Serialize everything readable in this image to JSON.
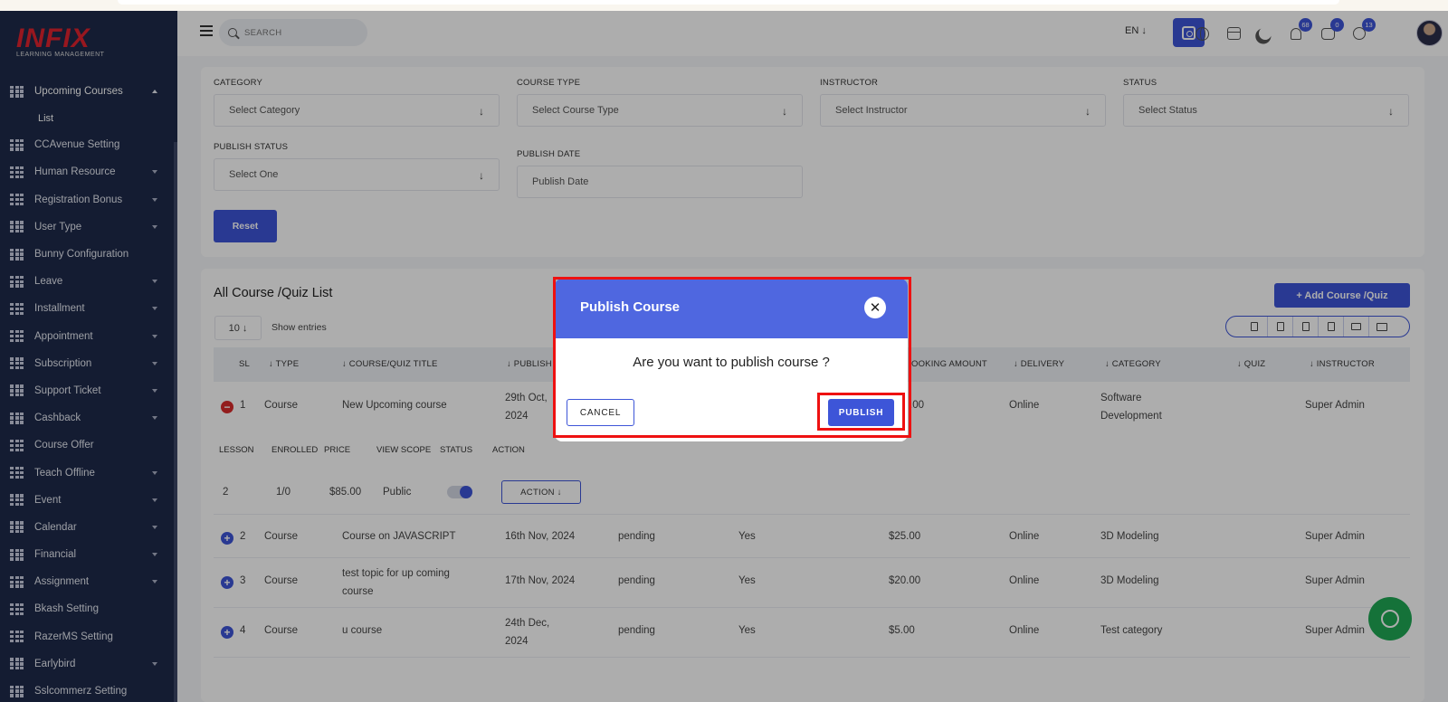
{
  "brand": {
    "logo_text": "INFIX",
    "logo_sub": "LEARNING MANAGEMENT"
  },
  "sidebar": {
    "items": [
      {
        "label": "Upcoming Courses",
        "caret": "up"
      },
      {
        "label": "List",
        "sub": true
      },
      {
        "label": "CCAvenue Setting",
        "caret": ""
      },
      {
        "label": "Human Resource",
        "caret": "down"
      },
      {
        "label": "Registration Bonus",
        "caret": "down"
      },
      {
        "label": "User Type",
        "caret": "down"
      },
      {
        "label": "Bunny Configuration",
        "caret": ""
      },
      {
        "label": "Leave",
        "caret": "down"
      },
      {
        "label": "Installment",
        "caret": "down"
      },
      {
        "label": "Appointment",
        "caret": "down"
      },
      {
        "label": "Subscription",
        "caret": "down"
      },
      {
        "label": "Support Ticket",
        "caret": "down"
      },
      {
        "label": "Cashback",
        "caret": "down"
      },
      {
        "label": "Course Offer",
        "caret": ""
      },
      {
        "label": "Teach Offline",
        "caret": "down"
      },
      {
        "label": "Event",
        "caret": "down"
      },
      {
        "label": "Calendar",
        "caret": "down"
      },
      {
        "label": "Financial",
        "caret": "down"
      },
      {
        "label": "Assignment",
        "caret": "down"
      },
      {
        "label": "Bkash Setting",
        "caret": ""
      },
      {
        "label": "RazerMS Setting",
        "caret": ""
      },
      {
        "label": "Earlybird",
        "caret": "down"
      },
      {
        "label": "Sslcommerz Setting",
        "caret": ""
      }
    ]
  },
  "header": {
    "search_placeholder": "SEARCH",
    "lang": "EN ↓",
    "badges": {
      "notifications": "68",
      "messages": "0",
      "calls": "13"
    }
  },
  "filters": {
    "category_label": "CATEGORY",
    "category_value": "Select Category",
    "course_type_label": "COURSE TYPE",
    "course_type_value": "Select Course Type",
    "instructor_label": "INSTRUCTOR",
    "instructor_value": "Select Instructor",
    "status_label": "STATUS",
    "status_value": "Select Status",
    "publish_status_label": "PUBLISH STATUS",
    "publish_status_value": "Select One",
    "publish_date_label": "PUBLISH DATE",
    "publish_date_placeholder": "Publish Date",
    "reset_label": "Reset"
  },
  "list": {
    "title": "All Course /Quiz List",
    "add_label": "+ Add Course /Quiz",
    "per_page": "10 ↓",
    "show_entries": "Show entries",
    "columns": [
      "SL",
      "↓ TYPE",
      "↓ COURSE/QUIZ TITLE",
      "↓ PUBLISH",
      "OOKING AMOUNT",
      "↓ DELIVERY",
      "↓ CATEGORY",
      "↓ QUIZ",
      "↓ INSTRUCTOR"
    ],
    "rows": [
      {
        "sl": "1",
        "type": "Course",
        "title": "New Upcoming course",
        "publish": "29th Oct, 2024",
        "status": "",
        "flag": "",
        "amount": ".00",
        "delivery": "Online",
        "category": "Software Development",
        "instructor": "Super Admin"
      },
      {
        "sl": "2",
        "type": "Course",
        "title": "Course on JAVASCRIPT",
        "publish": "16th Nov, 2024",
        "status": "pending",
        "flag": "Yes",
        "amount": "$25.00",
        "delivery": "Online",
        "category": "3D Modeling",
        "instructor": "Super Admin"
      },
      {
        "sl": "3",
        "type": "Course",
        "title": "test topic for up coming course",
        "publish": "17th Nov, 2024",
        "status": "pending",
        "flag": "Yes",
        "amount": "$20.00",
        "delivery": "Online",
        "category": "3D Modeling",
        "instructor": "Super Admin"
      },
      {
        "sl": "4",
        "type": "Course",
        "title": "u course",
        "publish": "24th Dec, 2024",
        "status": "pending",
        "flag": "Yes",
        "amount": "$5.00",
        "delivery": "Online",
        "category": "Test category",
        "instructor": "Super Admin"
      }
    ],
    "expanded": {
      "headers": [
        "LESSON",
        "ENROLLED",
        "PRICE",
        "VIEW SCOPE",
        "STATUS",
        "ACTION"
      ],
      "lesson": "2",
      "enrolled": "1/0",
      "price": "$85.00",
      "view_scope": "Public",
      "status_on": true,
      "action_label": "ACTION ↓"
    }
  },
  "modal": {
    "title": "Publish Course",
    "close_glyph": "✕",
    "message": "Are you want to publish course ?",
    "cancel_label": "CANCEL",
    "publish_label": "PUBLISH"
  },
  "colors": {
    "accent": "#3d55d8",
    "sidebar": "#1e2a4a",
    "highlight": "#ee1111",
    "whatsapp": "#1fa855"
  }
}
